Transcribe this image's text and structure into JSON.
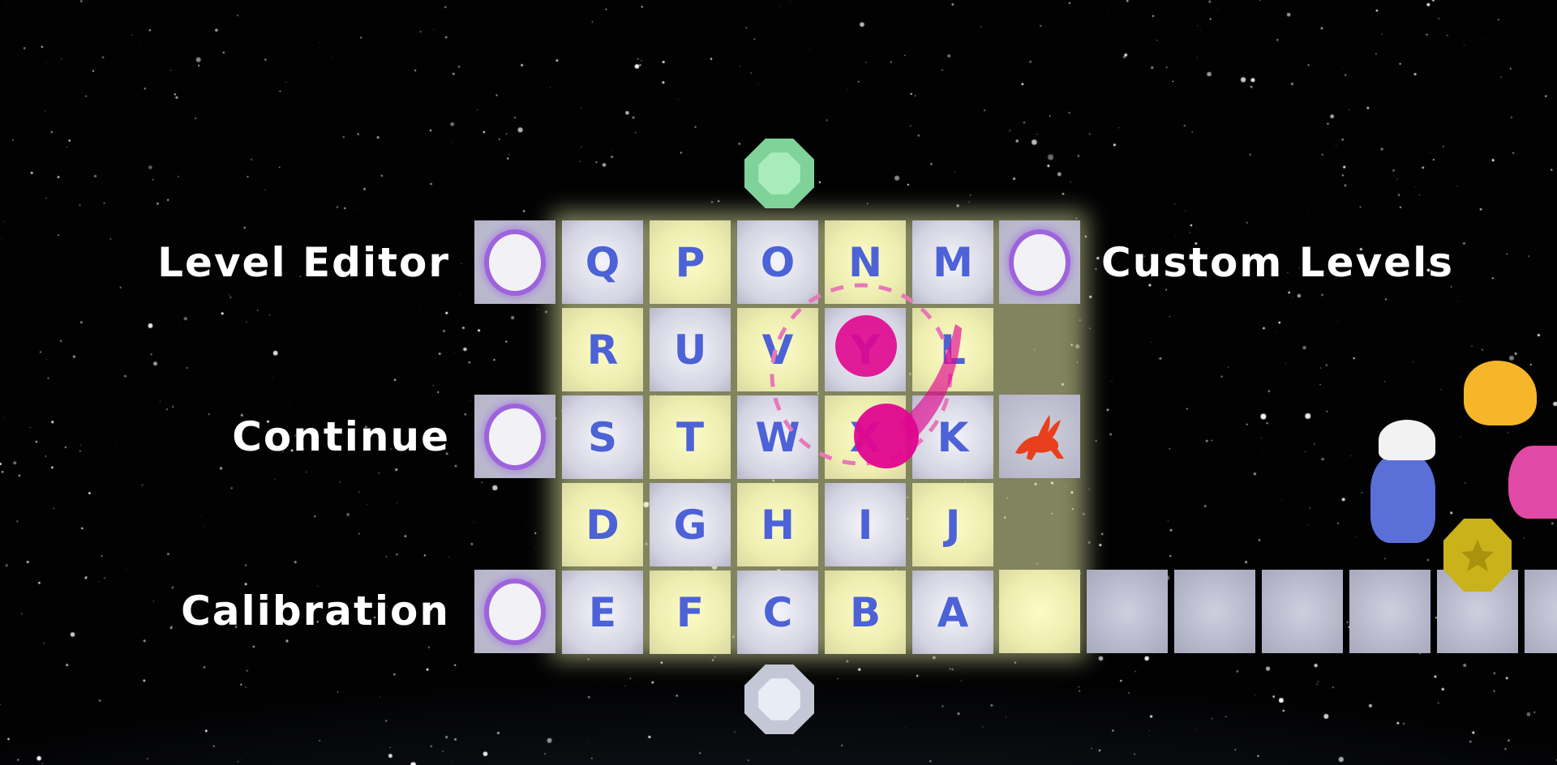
{
  "menu": {
    "level_editor": "Level Editor",
    "custom_levels": "Custom Levels",
    "continue": "Continue",
    "calibration": "Calibration"
  },
  "grid": {
    "rows": [
      [
        "Q",
        "P",
        "O",
        "N",
        "M"
      ],
      [
        "R",
        "U",
        "V",
        "Y",
        "L"
      ],
      [
        "S",
        "T",
        "W",
        "X",
        "K"
      ],
      [
        "D",
        "G",
        "H",
        "I",
        "J"
      ],
      [
        "E",
        "F",
        "C",
        "B",
        "A"
      ]
    ],
    "highlighted_letters": [
      "P",
      "N",
      "R",
      "V",
      "L",
      "T",
      "X",
      "D",
      "H",
      "J",
      "F",
      "B"
    ],
    "cursor_letters": [
      "Y",
      "X"
    ]
  },
  "icons": {
    "top_gem": "green-gem-icon",
    "bottom_gem": "white-gem-icon",
    "rabbit": "rabbit-icon",
    "coin": "yellow-star-coin-icon"
  },
  "colors": {
    "letter": "#4c62d6",
    "cursor": "#e0068f",
    "highlight": "#f2f2b0",
    "portal": "#9d63dc",
    "rabbit": "#e8401c"
  }
}
